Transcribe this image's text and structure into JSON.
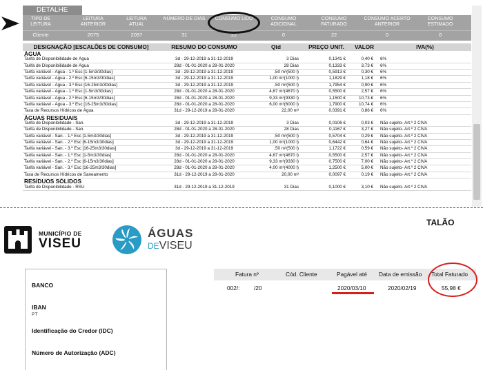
{
  "detail": {
    "tab_label": "DETALHE",
    "summary": [
      {
        "header": "TIPO DE LEITURA",
        "value": "Cliente"
      },
      {
        "header": "LEITURA ANTERIOR",
        "value": "2075"
      },
      {
        "header": "LEITURA ATUAL",
        "value": "2097"
      },
      {
        "header": "NÚMERO DE DIAS",
        "value": "31"
      },
      {
        "header": "CONSUMO LIDO",
        "value": "22"
      },
      {
        "header": "CONSUMO ADICIONAL",
        "value": "0"
      },
      {
        "header": "CONSUMO FATURADO",
        "value": "22"
      },
      {
        "header": "CONSUMO ACERTO ANTERIOR",
        "value": "0"
      },
      {
        "header": "CONSUMO ESTIMADO",
        "value": "0"
      }
    ],
    "table_headers": [
      "DESIGNAÇÃO [ESCALÕES DE CONSUMO]",
      "RESUMO DO CONSUMO",
      "Qtd",
      "PREÇO UNIT.",
      "VALOR",
      "IVA(%)"
    ],
    "sections": [
      {
        "title": "ÁGUA",
        "rows": [
          [
            "Tarifa de Disponibilidade de Água",
            "3d - 29-12-2019 a 31-12-2019",
            "3 Dias",
            "0,1341 €",
            "0,40 €",
            "6%"
          ],
          [
            "Tarifa de Disponibilidade de Água",
            "28d - 01-01-2020 a 28-01-2020",
            "28 Dias",
            "0,1333 €",
            "3,73 €",
            "6%"
          ],
          [
            "Tarifa variável - Água - 1.º Esc [1-5m3/30dias]",
            "3d - 29-12-2019 a 31-12-2019",
            ",50 m³(500 l)",
            "0,5913 €",
            "0,30 €",
            "6%"
          ],
          [
            "Tarifa variável - Água - 2.º Esc [6-15m3/30dias]",
            "3d - 29-12-2019 a 31-12-2019",
            "1,00 m³(1000 l)",
            "1,1829 €",
            "1,18 €",
            "6%"
          ],
          [
            "Tarifa variável - Água - 3.º Esc [16-25m3/30dias]",
            "3d - 29-12-2019 a 31-12-2019",
            ",50 m³(500 l)",
            "1,7954 €",
            "0,90 €",
            "6%"
          ],
          [
            "Tarifa variável - Água - 1.º Esc [1-5m3/30dias]",
            "28d - 01-01-2020 a 28-01-2020",
            "4,67 m³(4670 l)",
            "0,5500 €",
            "2,57 €",
            "6%"
          ],
          [
            "Tarifa variável - Água - 2.º Esc [6-15m3/30dias]",
            "28d - 01-01-2020 a 28-01-2020",
            "9,33 m³(9330 l)",
            "1,1500 €",
            "10,73 €",
            "6%"
          ],
          [
            "Tarifa variável - Água - 3.º Esc [16-25m3/30dias]",
            "28d - 01-01-2020 a 28-01-2020",
            "6,00 m³(6000 l)",
            "1,7900 €",
            "10,74 €",
            "6%"
          ],
          [
            "Taxa de Recursos Hídricos de Água",
            "31d - 29-12-2019 a 28-01-2020",
            "22,00 m³",
            "0,0391 €",
            "0,86 €",
            "6%"
          ]
        ]
      },
      {
        "title": "ÁGUAS RESIDUAIS",
        "rows": [
          [
            "Tarifa de Disponibilidade - San.",
            "3d - 29-12-2019 a 31-12-2019",
            "3 Dias",
            "0,0106 €",
            "0,03 €",
            "Não sujeito- Art.º 2 CIVA"
          ],
          [
            "Tarifa de Disponibilidade - San.",
            "28d - 01-01-2020 a 28-01-2020",
            "28 Dias",
            "0,1167 €",
            "3,27 €",
            "Não sujeito- Art.º 2 CIVA"
          ],
          [
            "Tarifa variável - San. - 1.º Esc [1-5m3/30dias]",
            "3d - 29-12-2019 a 31-12-2019",
            ",50 m³(500 l)",
            "0,5704 €",
            "0,29 €",
            "Não sujeito- Art.º 2 CIVA"
          ],
          [
            "Tarifa variável - San. - 2.º Esc [6-15m3/30dias]",
            "3d - 29-12-2019 a 31-12-2019",
            "1,00 m³(1000 l)",
            "0,6442 €",
            "0,64 €",
            "Não sujeito- Art.º 2 CIVA"
          ],
          [
            "Tarifa variável - San. - 3.º Esc [16-25m3/30dias]",
            "3d - 29-12-2019 a 31-12-2019",
            ",50 m³(500 l)",
            "1,1722 €",
            "0,59 €",
            "Não sujeito- Art.º 2 CIVA"
          ],
          [
            "Tarifa variável - San. - 1.º Esc [1-5m3/30dias]",
            "28d - 01-01-2020 a 28-01-2020",
            "4,67 m³(4670 l)",
            "0,5500 €",
            "2,57 €",
            "Não sujeito- Art.º 2 CIVA"
          ],
          [
            "Tarifa variável - San. - 2.º Esc [6-15m3/30dias]",
            "28d - 01-01-2020 a 28-01-2020",
            "9,33 m³(9330 l)",
            "0,7500 €",
            "7,00 €",
            "Não sujeito- Art.º 2 CIVA"
          ],
          [
            "Tarifa variável - San. - 3.º Esc [16-25m3/30dias]",
            "28d - 01-01-2020 a 28-01-2020",
            "4,00 m³(4000 l)",
            "1,2500 €",
            "5,00 €",
            "Não sujeito- Art.º 2 CIVA"
          ],
          [
            "Taxa de Recursos Hídricos de Saneamento",
            "31d - 29-12-2019 a 28-01-2020",
            "20,00 m³",
            "0,0097 €",
            "0,19 €",
            "Não sujeito- Art.º 2 CIVA"
          ]
        ]
      },
      {
        "title": "RESÍDUOS SÓLIDOS",
        "rows": [
          [
            "Tarifa de Disponibilidade - RSU",
            "31d - 29-12-2019 a 31-12-2019",
            "31 Dias",
            "0,1000 €",
            "3,10 €",
            "Não sujeito- Art.º 2 CIVA"
          ]
        ]
      }
    ]
  },
  "talao": {
    "title": "TALÃO",
    "logo_viseu": {
      "small": "MUNICÍPIO DE",
      "big": "VISEU"
    },
    "logo_aguas": {
      "line1": "ÁGUAS",
      "line2_prefix": "DE",
      "line2_main": "VISEU"
    },
    "bank": {
      "banco_label": "BANCO",
      "iban_label": "IBAN",
      "iban_value": "PT",
      "idc_label": "Identificação do Credor (IDC)",
      "adc_label": "Número de Autorização (ADC)"
    },
    "invoice_headers": [
      "Fatura nº",
      "Cód. Cliente",
      "Pagável até",
      "Data de emissão",
      "Total Faturado"
    ],
    "invoice_values": {
      "fatura_prefix": "002/:",
      "fatura_suffix": "/20",
      "cod_cliente": "",
      "pagavel_ate": "2020/03/10",
      "data_emissao": "2020/02/19",
      "total": "55,98 €"
    }
  },
  "colors": {
    "highlight_red": "#d61f1f",
    "header_gray": "#a3a3a3"
  }
}
